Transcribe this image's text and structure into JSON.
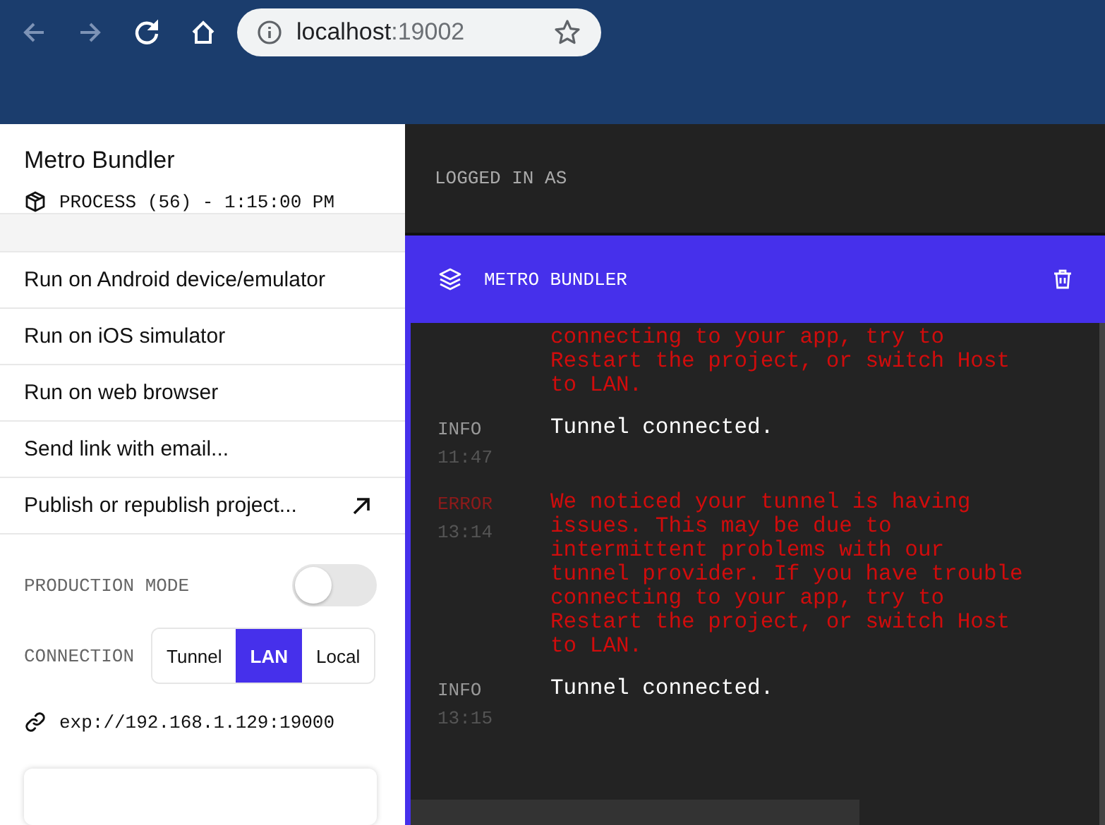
{
  "browser": {
    "url_host": "localhost",
    "url_port": ":19002",
    "back_disabled": true,
    "forward_disabled": true
  },
  "sidebar": {
    "title": "Metro Bundler",
    "process": "PROCESS (56) - 1:15:00 PM",
    "menu": [
      {
        "label": "Run on Android device/emulator",
        "external": false
      },
      {
        "label": "Run on iOS simulator",
        "external": false
      },
      {
        "label": "Run on web browser",
        "external": false
      },
      {
        "label": "Send link with email...",
        "external": false
      },
      {
        "label": "Publish or republish project...",
        "external": true
      }
    ],
    "production_mode": {
      "label": "PRODUCTION MODE",
      "on": false
    },
    "connection": {
      "label": "CONNECTION",
      "options": [
        {
          "label": "Tunnel",
          "selected": false
        },
        {
          "label": "LAN",
          "selected": true
        },
        {
          "label": "Local",
          "selected": false
        }
      ]
    },
    "url": "exp://192.168.1.129:19000"
  },
  "main": {
    "logged_in": "LOGGED IN AS",
    "panel_title": "METRO BUNDLER",
    "log": [
      {
        "kind": "error",
        "message": "connecting to your app, try to Restart the project, or switch Host to LAN."
      },
      {
        "kind": "info",
        "level": "INFO",
        "time": "11:47",
        "message": "Tunnel connected."
      },
      {
        "kind": "error",
        "level": "ERROR",
        "time": "13:14",
        "message": "We noticed your tunnel is having issues. This may be due to intermittent problems with our tunnel provider. If you have trouble connecting to your app, try to Restart the project, or switch Host to LAN."
      },
      {
        "kind": "info",
        "level": "INFO",
        "time": "13:15",
        "message": "Tunnel connected."
      }
    ]
  }
}
